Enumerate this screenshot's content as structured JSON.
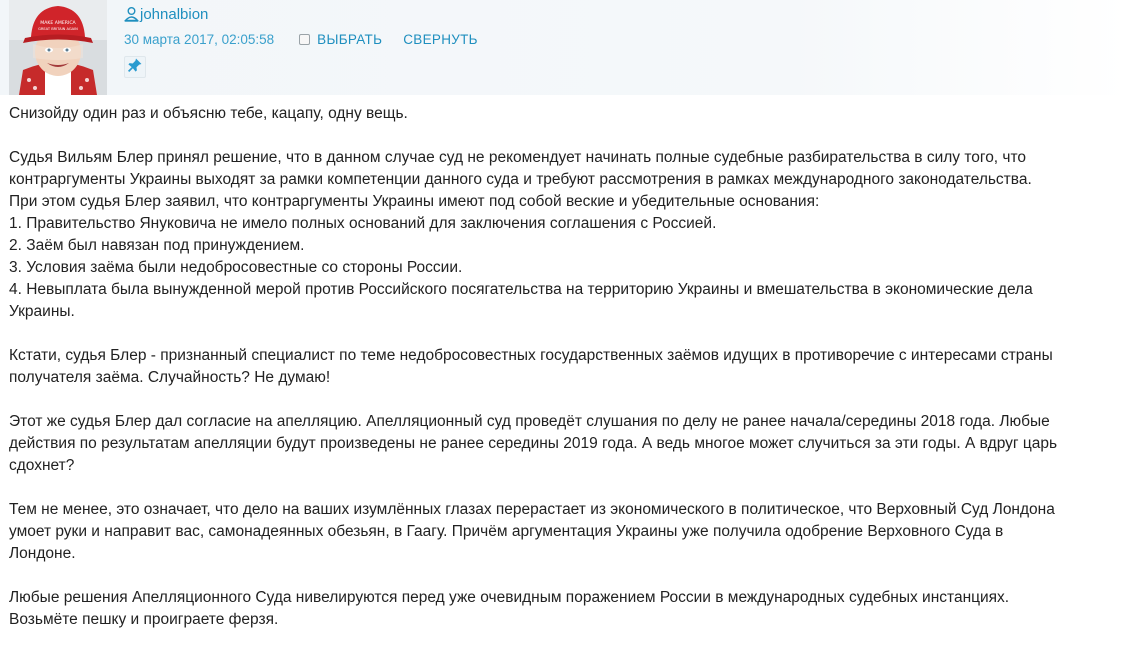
{
  "comment": {
    "author": "johnalbion",
    "timestamp": "30 марта 2017, 02:05:58",
    "select_label": "ВЫБРАТЬ",
    "collapse_label": "СВЕРНУТЬ",
    "avatar_icon": "avatar-user-photo",
    "user_icon": "user-icon",
    "pin_icon": "pin-icon",
    "colors": {
      "link": "#1f8fbf",
      "timestamp": "#3aa0cc",
      "text": "#222222",
      "header_bg": "#f2f6f9"
    },
    "paragraphs": [
      {
        "lines": [
          "Снизойду один раз и объясню тебе, кацапу, одну вещь."
        ]
      },
      {
        "lines": [
          "Судья Вильям Блер принял решение, что в данном случае суд не рекомендует начинать полные судебные разбирательства в силу того, что",
          "контраргументы Украины выходят за рамки компетенции данного суда и требуют рассмотрения в рамках международного законодательства.",
          "При этом судья Блер заявил, что контраргументы Украины имеют под собой веские и убедительные основания:",
          "1. Правительство Януковича не имело полных оснований для заключения соглашения с Россией.",
          "2. Заём был навязан под принуждением.",
          "3. Условия заёма были недобросовестные со стороны России.",
          "4. Невыплата была вынужденной мерой против Российского посягательства на территорию Украины и вмешательства в экономические дела",
          "Украины."
        ]
      },
      {
        "lines": [
          "Кстати, судья Блер - признанный специалист по теме недобросовестных государственных заёмов идущих в противоречие с интересами страны",
          "получателя заёма. Случайность? Не думаю!"
        ]
      },
      {
        "lines": [
          "Этот же судья Блер дал согласие на апелляцию. Апелляционный суд проведёт слушания по делу не ранее начала/середины 2018 года. Любые",
          "действия по результатам апелляции будут произведены не ранее середины 2019 года. А ведь многое может случиться за эти годы. А вдруг царь",
          "сдохнет?"
        ]
      },
      {
        "lines": [
          "Тем не менее, это означает, что дело на ваших изумлённых глазах перерастает из экономического в политическое, что Верховный Суд Лондона",
          "умоет руки и направит вас, самонадеянных обезьян, в Гаагу. Причём аргументация Украины уже получила одобрение Верховного Суда в",
          "Лондоне."
        ]
      },
      {
        "lines": [
          "Любые решения Апелляционного Суда нивелируются перед уже очевидным поражением России в международных судебных инстанциях.",
          "Возьмёте пешку и проиграете ферзя."
        ]
      }
    ]
  }
}
